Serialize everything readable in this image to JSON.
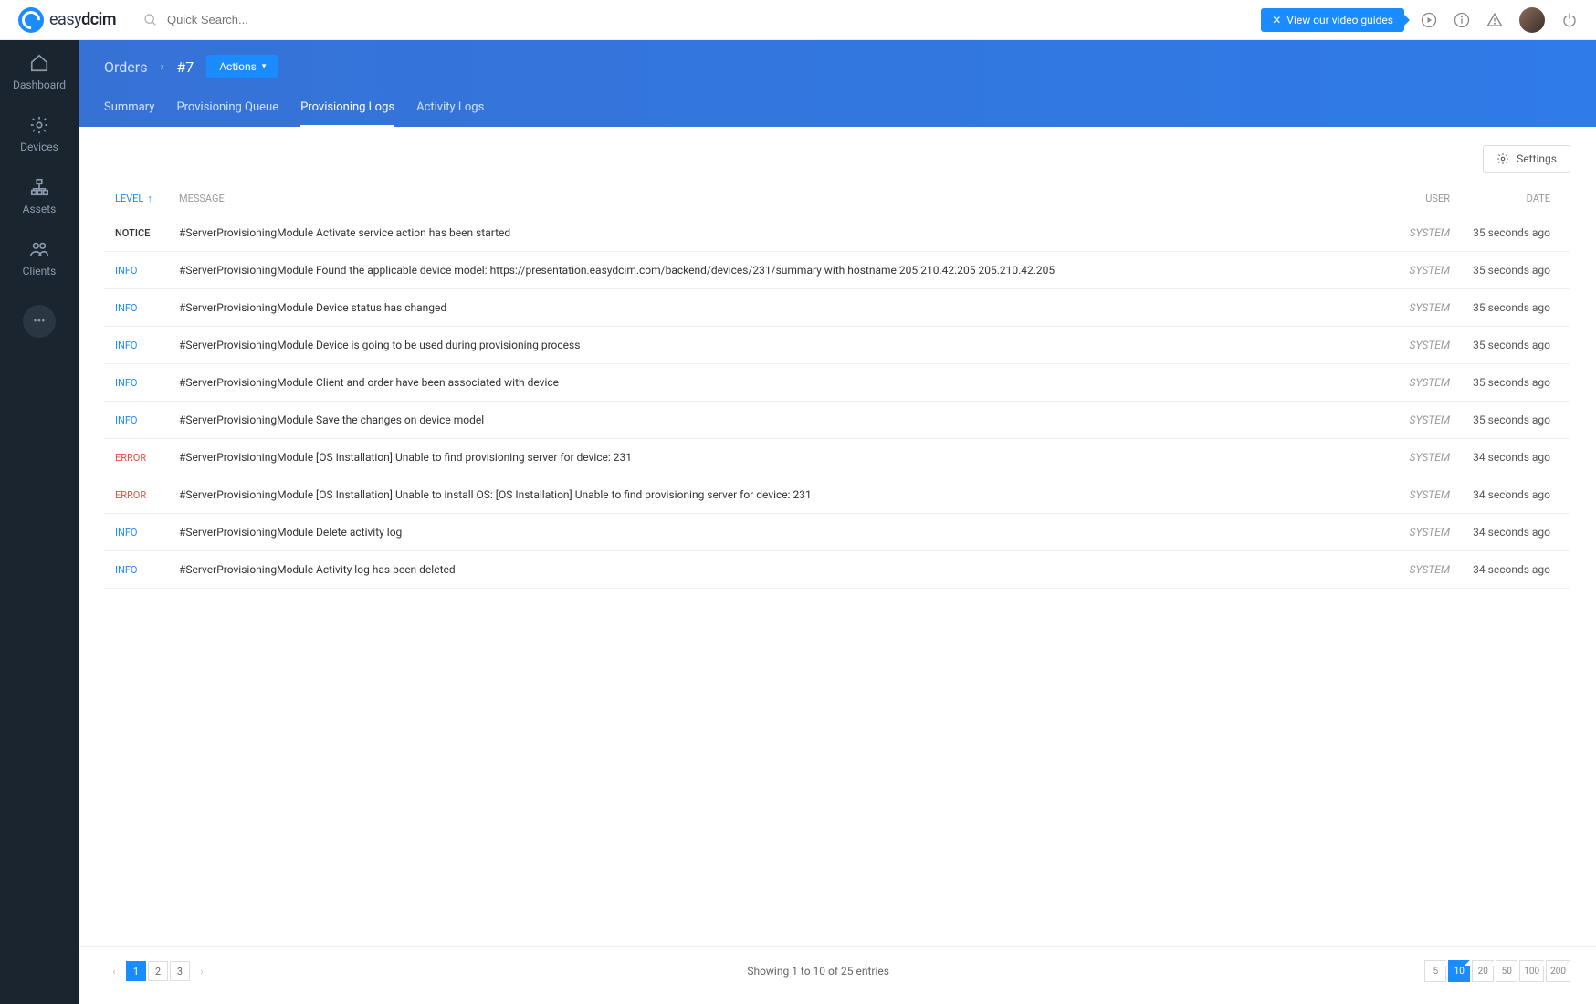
{
  "brand": {
    "part1": "easy",
    "part2": "dcim"
  },
  "search": {
    "placeholder": "Quick Search..."
  },
  "topbar": {
    "video_guides": "View our video guides"
  },
  "sidebar": {
    "items": [
      {
        "label": "Dashboard"
      },
      {
        "label": "Devices"
      },
      {
        "label": "Assets"
      },
      {
        "label": "Clients"
      }
    ],
    "more": "•••"
  },
  "breadcrumb": {
    "root": "Orders",
    "current": "#7",
    "actions_label": "Actions"
  },
  "tabs": [
    {
      "label": "Summary",
      "active": false
    },
    {
      "label": "Provisioning Queue",
      "active": false
    },
    {
      "label": "Provisioning Logs",
      "active": true
    },
    {
      "label": "Activity Logs",
      "active": false
    }
  ],
  "toolbar": {
    "settings_label": "Settings"
  },
  "table": {
    "headers": {
      "level": "LEVEL",
      "message": "MESSAGE",
      "user": "USER",
      "date": "DATE"
    },
    "rows": [
      {
        "level": "NOTICE",
        "message": "#ServerProvisioningModule Activate service action has been started",
        "user": "SYSTEM",
        "date": "35 seconds ago"
      },
      {
        "level": "INFO",
        "message": "#ServerProvisioningModule Found the applicable device model: https://presentation.easydcim.com/backend/devices/231/summary with hostname 205.210.42.205 205.210.42.205",
        "user": "SYSTEM",
        "date": "35 seconds ago"
      },
      {
        "level": "INFO",
        "message": "#ServerProvisioningModule Device status has changed",
        "user": "SYSTEM",
        "date": "35 seconds ago"
      },
      {
        "level": "INFO",
        "message": "#ServerProvisioningModule Device is going to be used during provisioning process",
        "user": "SYSTEM",
        "date": "35 seconds ago"
      },
      {
        "level": "INFO",
        "message": "#ServerProvisioningModule Client and order have been associated with device",
        "user": "SYSTEM",
        "date": "35 seconds ago"
      },
      {
        "level": "INFO",
        "message": "#ServerProvisioningModule Save the changes on device model",
        "user": "SYSTEM",
        "date": "35 seconds ago"
      },
      {
        "level": "ERROR",
        "message": "#ServerProvisioningModule [OS Installation] Unable to find provisioning server for device: 231",
        "user": "SYSTEM",
        "date": "34 seconds ago"
      },
      {
        "level": "ERROR",
        "message": "#ServerProvisioningModule [OS Installation] Unable to install OS: [OS Installation] Unable to find provisioning server for device: 231",
        "user": "SYSTEM",
        "date": "34 seconds ago"
      },
      {
        "level": "INFO",
        "message": "#ServerProvisioningModule Delete activity log",
        "user": "SYSTEM",
        "date": "34 seconds ago"
      },
      {
        "level": "INFO",
        "message": "#ServerProvisioningModule Activity log has been deleted",
        "user": "SYSTEM",
        "date": "34 seconds ago"
      }
    ]
  },
  "footer": {
    "showing": "Showing 1 to 10 of 25 entries",
    "pages": [
      "1",
      "2",
      "3"
    ],
    "active_page": "1",
    "page_sizes": [
      "5",
      "10",
      "20",
      "50",
      "100",
      "200"
    ],
    "active_size": "10"
  }
}
